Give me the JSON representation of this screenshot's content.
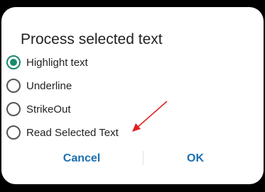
{
  "dialog": {
    "title": "Process selected text",
    "options": [
      {
        "label": "Highlight text",
        "checked": true
      },
      {
        "label": "Underline",
        "checked": false
      },
      {
        "label": "StrikeOut",
        "checked": false
      },
      {
        "label": "Read Selected Text",
        "checked": false
      }
    ],
    "cancel_label": "Cancel",
    "ok_label": "OK"
  },
  "colors": {
    "accent": "#1a8a6e",
    "button_text": "#1c6fb0",
    "annotation_arrow": "#e02020"
  }
}
